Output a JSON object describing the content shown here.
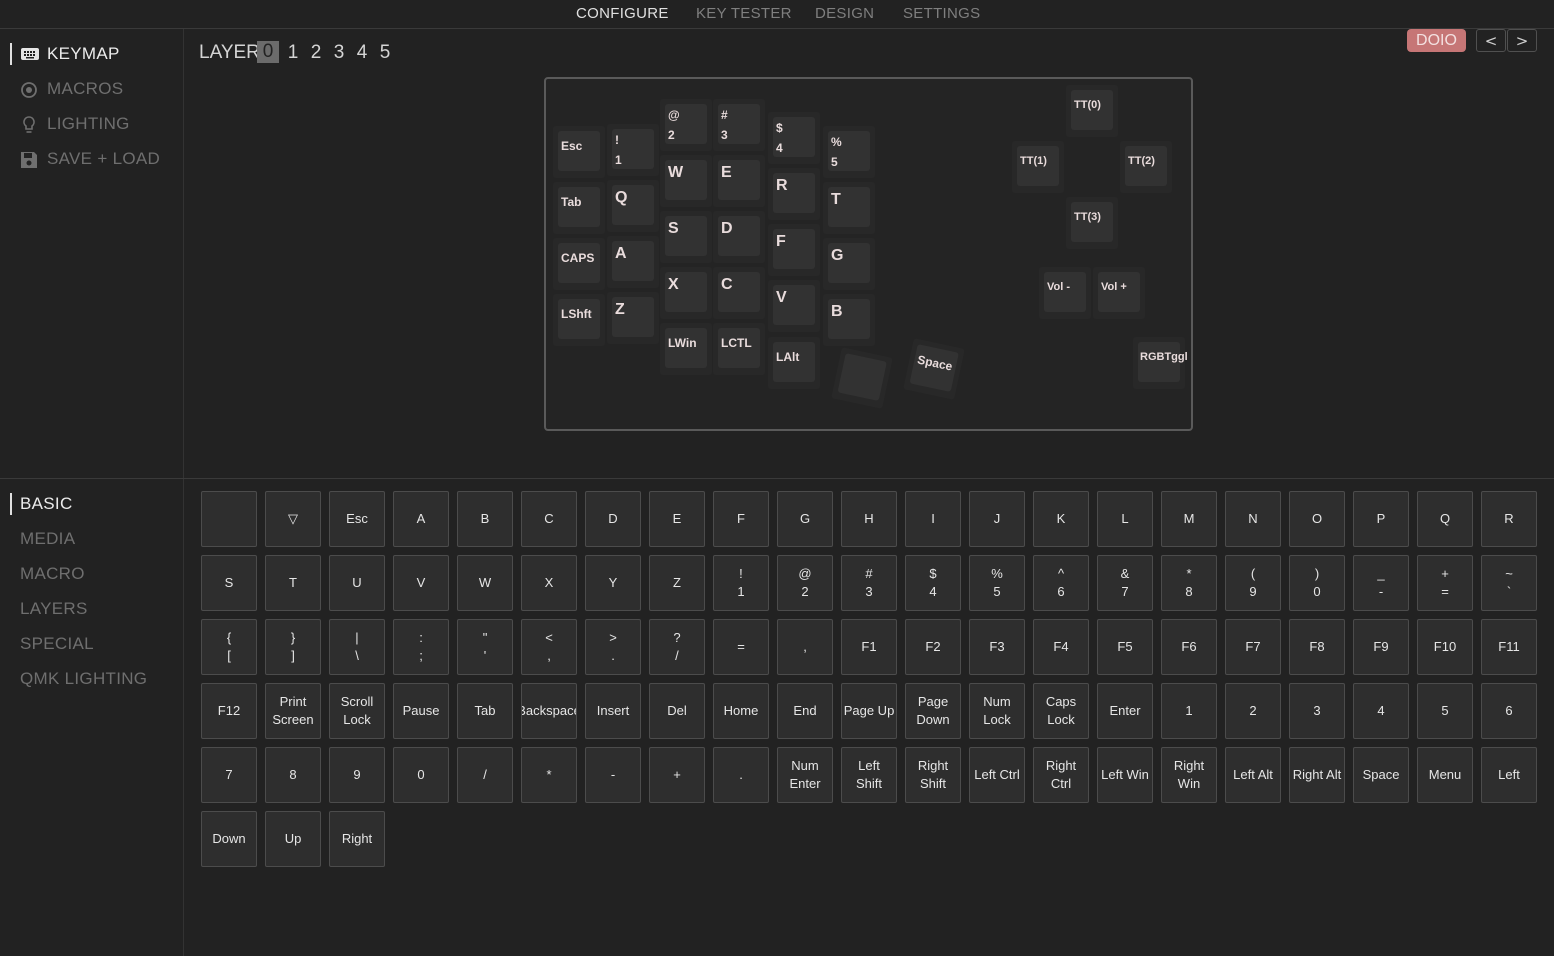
{
  "nav": {
    "tabs": [
      "CONFIGURE",
      "KEY TESTER",
      "DESIGN",
      "SETTINGS"
    ],
    "active": "CONFIGURE"
  },
  "sidebar_top": {
    "items": [
      {
        "label": "KEYMAP",
        "icon": "keyboard-icon",
        "active": true
      },
      {
        "label": "MACROS",
        "icon": "macro-circle-icon",
        "active": false
      },
      {
        "label": "LIGHTING",
        "icon": "lightbulb-icon",
        "active": false
      },
      {
        "label": "SAVE + LOAD",
        "icon": "floppy-disk-icon",
        "active": false
      }
    ]
  },
  "layers": {
    "label": "LAYER",
    "numbers": [
      "0",
      "1",
      "2",
      "3",
      "4",
      "5"
    ],
    "selected": "0"
  },
  "device": {
    "name": "DOIO",
    "prev": "<",
    "next": ">",
    "badge_color": "#c67676"
  },
  "keyboard": {
    "keys": [
      {
        "t": "Esc"
      },
      {
        "t": "!\n1"
      },
      {
        "t": "@\n2"
      },
      {
        "t": "#\n3"
      },
      {
        "t": "$\n4"
      },
      {
        "t": "%\n5"
      },
      {
        "t": "Tab"
      },
      {
        "t": "Q"
      },
      {
        "t": "W"
      },
      {
        "t": "E"
      },
      {
        "t": "R"
      },
      {
        "t": "T"
      },
      {
        "t": "CAPS"
      },
      {
        "t": "A"
      },
      {
        "t": "S"
      },
      {
        "t": "D"
      },
      {
        "t": "F"
      },
      {
        "t": "G"
      },
      {
        "t": "LShft"
      },
      {
        "t": "Z"
      },
      {
        "t": "X"
      },
      {
        "t": "C"
      },
      {
        "t": "V"
      },
      {
        "t": "B"
      },
      {
        "t": "LWin"
      },
      {
        "t": "LCTL"
      },
      {
        "t": "LAlt"
      },
      {
        "t": ""
      },
      {
        "t": "Space"
      },
      {
        "t": "TT(0)"
      },
      {
        "t": "TT(1)"
      },
      {
        "t": "TT(2)"
      },
      {
        "t": "TT(3)"
      },
      {
        "t": "Vol -"
      },
      {
        "t": "Vol +"
      },
      {
        "t": "RGBTggl"
      }
    ]
  },
  "sidebar_bottom": {
    "items": [
      {
        "label": "BASIC",
        "active": true
      },
      {
        "label": "MEDIA",
        "active": false
      },
      {
        "label": "MACRO",
        "active": false
      },
      {
        "label": "LAYERS",
        "active": false
      },
      {
        "label": "SPECIAL",
        "active": false
      },
      {
        "label": "QMK LIGHTING",
        "active": false
      }
    ]
  },
  "basic_keys": [
    "",
    "▽",
    "Esc",
    "A",
    "B",
    "C",
    "D",
    "E",
    "F",
    "G",
    "H",
    "I",
    "J",
    "K",
    "L",
    "M",
    "N",
    "O",
    "P",
    "Q",
    "R",
    "S",
    "T",
    "U",
    "V",
    "W",
    "X",
    "Y",
    "Z",
    "!\n1",
    "@\n2",
    "#\n3",
    "$\n4",
    "%\n5",
    "^\n6",
    "&\n7",
    "*\n8",
    "(\n9",
    ")\n0",
    "_\n-",
    "+\n=",
    "~\n`",
    "{\n[",
    "}\n]",
    "|\n\\",
    ":\n;",
    "\"\n'",
    "<\n,",
    ">\n.",
    "?\n/",
    "=",
    ",",
    "F1",
    "F2",
    "F3",
    "F4",
    "F5",
    "F6",
    "F7",
    "F8",
    "F9",
    "F10",
    "F11",
    "F12",
    "Print\nScreen",
    "Scroll\nLock",
    "Pause",
    "Tab",
    "Backspace",
    "Insert",
    "Del",
    "Home",
    "End",
    "Page Up",
    "Page\nDown",
    "Num\nLock",
    "Caps\nLock",
    "Enter",
    "1",
    "2",
    "3",
    "4",
    "5",
    "6",
    "7",
    "8",
    "9",
    "0",
    "/",
    "*",
    "-",
    "+",
    ".",
    "Num\nEnter",
    "Left\nShift",
    "Right\nShift",
    "Left Ctrl",
    "Right\nCtrl",
    "Left Win",
    "Right\nWin",
    "Left Alt",
    "Right Alt",
    "Space",
    "Menu",
    "Left",
    "Down",
    "Up",
    "Right"
  ]
}
